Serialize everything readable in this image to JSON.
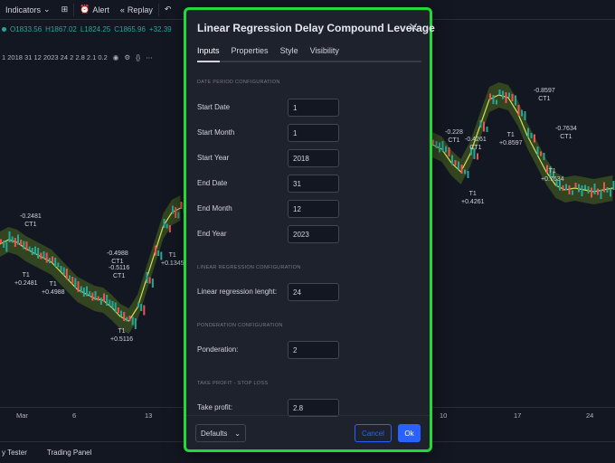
{
  "toolbar": {
    "indicators": "Indicators",
    "alert": "Alert",
    "replay": "Replay"
  },
  "ohlc": {
    "open": "O1833.56",
    "high": "H1867.02",
    "low": "L1824.25",
    "close": "C1865.96",
    "change": "+32.39"
  },
  "indicator_line": "1 2018 31 12 2023 24 2 2.8 2.1 0.2",
  "chart_labels": [
    {
      "top": "-0.2481",
      "mid": "CT1"
    },
    {
      "top": "T1",
      "mid": "+0.2481"
    },
    {
      "top": "T1",
      "mid": "+0.4988"
    },
    {
      "top": "-0.4988",
      "mid": "CT1"
    },
    {
      "top": "-0.5116",
      "mid": "CT1"
    },
    {
      "top": "T1",
      "mid": "+0.5116"
    },
    {
      "top": "T1",
      "mid": "+0.1345"
    },
    {
      "top": "-0.228",
      "mid": "CT1"
    },
    {
      "top": "-0.4261",
      "mid": "CT1"
    },
    {
      "top": "T1",
      "mid": "+0.4261"
    },
    {
      "top": "-0.8597",
      "mid": "CT1"
    },
    {
      "top": "T1",
      "mid": "+0.8597"
    },
    {
      "top": "-0.7634",
      "mid": "CT1"
    },
    {
      "top": "T1",
      "mid": "+0.7634"
    }
  ],
  "xaxis": [
    "Mar",
    "6",
    "13",
    "10",
    "17",
    "24"
  ],
  "bottombar": {
    "tester": "y Tester",
    "trading": "Trading Panel"
  },
  "dialog": {
    "title": "Linear Regression Delay Compound Leverage",
    "tabs": [
      "Inputs",
      "Properties",
      "Style",
      "Visibility"
    ],
    "sections": {
      "date": "DATE PERIOD CONFIGURATION",
      "linreg": "LINEAR REGRESSION CONFIGURATION",
      "ponderation": "PONDERATION CONFIGURATION",
      "tpsl": "TAKE PROFIT - STOP LOSS"
    },
    "fields": [
      {
        "label": "Start Date",
        "value": "1"
      },
      {
        "label": "Start Month",
        "value": "1"
      },
      {
        "label": "Start Year",
        "value": "2018"
      },
      {
        "label": "End Date",
        "value": "31"
      },
      {
        "label": "End Month",
        "value": "12"
      },
      {
        "label": "End Year",
        "value": "2023"
      },
      {
        "label": "Linear regression lenght:",
        "value": "24"
      },
      {
        "label": "Ponderation:",
        "value": "2"
      },
      {
        "label": "Take profit:",
        "value": "2.8"
      }
    ],
    "defaults": "Defaults",
    "cancel": "Cancel",
    "ok": "Ok"
  },
  "colors": {
    "accent": "#2962ff",
    "highlight": "#22d93a",
    "up": "#26a69a",
    "down": "#ef5350",
    "band": "#4c6b1f"
  }
}
